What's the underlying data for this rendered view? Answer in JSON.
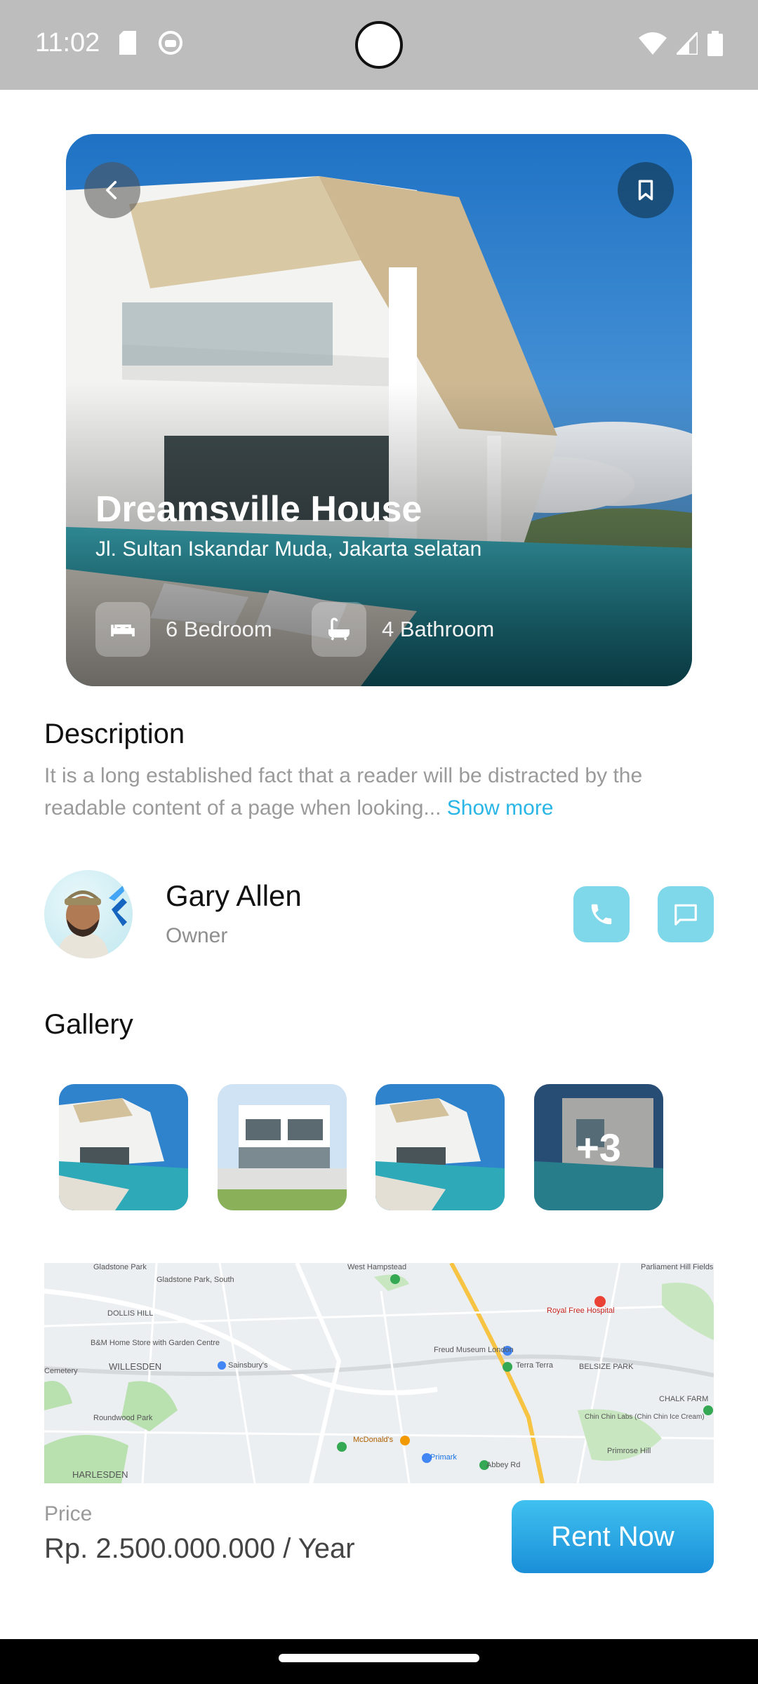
{
  "status_bar": {
    "time": "11:02"
  },
  "hero": {
    "title": "Dreamsville House",
    "address": "Jl. Sultan Iskandar Muda, Jakarta selatan",
    "features": [
      {
        "icon": "bed-icon",
        "label": "6 Bedroom"
      },
      {
        "icon": "bathtub-icon",
        "label": "4 Bathroom"
      }
    ]
  },
  "description": {
    "heading": "Description",
    "text": "It is a long established fact that a reader will be distracted by the readable content of a page when looking...",
    "show_more": "Show more"
  },
  "owner": {
    "name": "Gary Allen",
    "role": "Owner"
  },
  "gallery": {
    "heading": "Gallery",
    "more_count": "+3"
  },
  "map": {
    "labels": [
      "Gladstone Park",
      "Gladstone Park, South",
      "West Hampstead",
      "DOLLIS HILL",
      "B&M Home Store with Garden Centre",
      "WILLESDEN",
      "Sainsbury's",
      "Freud Museum London",
      "Terra Terra",
      "BELSIZE PARK",
      "Royal Free Hospital",
      "Parliament Hill Fields Lido",
      "CHALK FARM",
      "Chin Chin Labs (Chin Chin Ice Cream)",
      "Primrose Hill",
      "Roundwood Park",
      "McDonald's",
      "Primark",
      "Abbey Rd",
      "HARLESDEN",
      "Cemetery"
    ]
  },
  "price": {
    "label": "Price",
    "value": "Rp. 2.500.000.000 / Year"
  },
  "cta": {
    "label": "Rent Now"
  },
  "colors": {
    "accent": "#29b6e6",
    "contact_bg": "#7fd7ea",
    "button_top": "#3fc1f0",
    "button_bottom": "#1a8fd8"
  }
}
